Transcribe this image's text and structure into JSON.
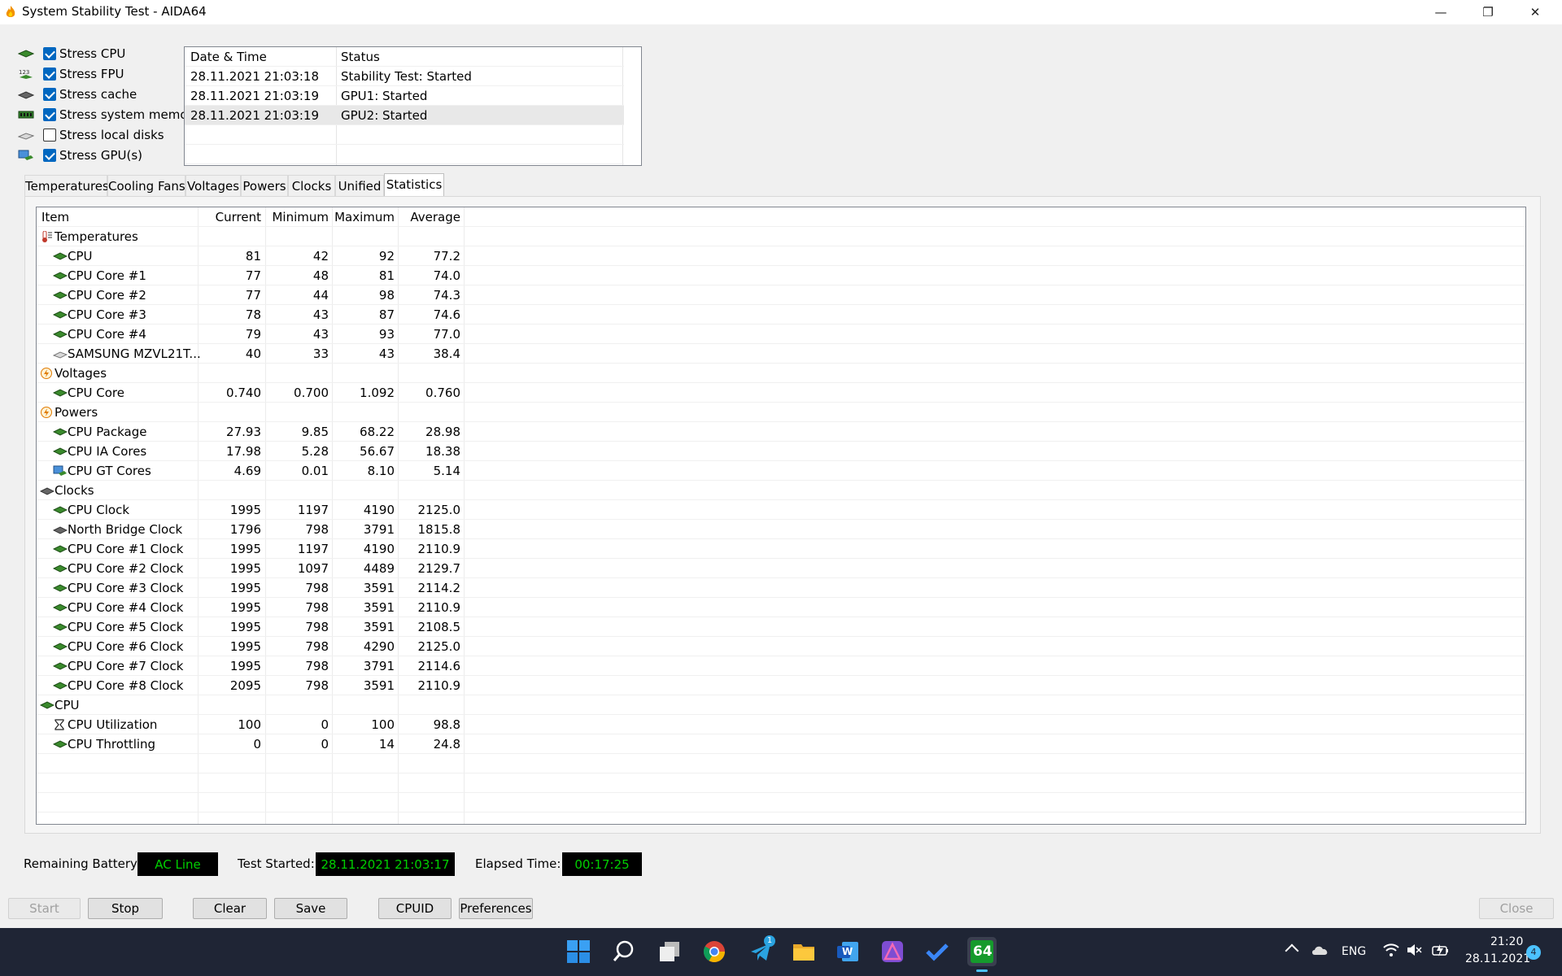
{
  "window": {
    "title": "System Stability Test - AIDA64",
    "minimize_glyph": "—",
    "restore_glyph": "❐",
    "close_glyph": "✕"
  },
  "stress_options": [
    {
      "label": "Stress CPU",
      "checked": true,
      "icon": "cpu-chip-icon"
    },
    {
      "label": "Stress FPU",
      "checked": true,
      "icon": "fpu-123-icon"
    },
    {
      "label": "Stress cache",
      "checked": true,
      "icon": "cache-chip-icon"
    },
    {
      "label": "Stress system memory",
      "checked": true,
      "icon": "memory-module-icon"
    },
    {
      "label": "Stress local disks",
      "checked": false,
      "icon": "disk-drive-icon"
    },
    {
      "label": "Stress GPU(s)",
      "checked": true,
      "icon": "gpu-monitor-icon"
    }
  ],
  "log": {
    "headers": [
      "Date & Time",
      "Status"
    ],
    "rows": [
      [
        "28.11.2021 21:03:18",
        "Stability Test: Started"
      ],
      [
        "28.11.2021 21:03:19",
        "GPU1: Started"
      ],
      [
        "28.11.2021 21:03:19",
        "GPU2: Started"
      ]
    ]
  },
  "tabs": [
    "Temperatures",
    "Cooling Fans",
    "Voltages",
    "Powers",
    "Clocks",
    "Unified",
    "Statistics"
  ],
  "active_tab": "Statistics",
  "stats": {
    "headers": [
      "Item",
      "Current",
      "Minimum",
      "Maximum",
      "Average"
    ],
    "rows": [
      {
        "group": true,
        "icon": "thermometer-icon",
        "item": "Temperatures",
        "cur": "",
        "min": "",
        "max": "",
        "avg": ""
      },
      {
        "icon": "cpu-chip-icon",
        "item": "CPU",
        "cur": "81",
        "min": "42",
        "max": "92",
        "avg": "77.2"
      },
      {
        "icon": "cpu-chip-icon",
        "item": "CPU Core #1",
        "cur": "77",
        "min": "48",
        "max": "81",
        "avg": "74.0"
      },
      {
        "icon": "cpu-chip-icon",
        "item": "CPU Core #2",
        "cur": "77",
        "min": "44",
        "max": "98",
        "avg": "74.3"
      },
      {
        "icon": "cpu-chip-icon",
        "item": "CPU Core #3",
        "cur": "78",
        "min": "43",
        "max": "87",
        "avg": "74.6"
      },
      {
        "icon": "cpu-chip-icon",
        "item": "CPU Core #4",
        "cur": "79",
        "min": "43",
        "max": "93",
        "avg": "77.0"
      },
      {
        "icon": "disk-drive-icon",
        "item": "SAMSUNG MZVL21T...",
        "cur": "40",
        "min": "33",
        "max": "43",
        "avg": "38.4"
      },
      {
        "group": true,
        "icon": "voltage-bolt-icon",
        "item": "Voltages",
        "cur": "",
        "min": "",
        "max": "",
        "avg": ""
      },
      {
        "icon": "cpu-chip-icon",
        "item": "CPU Core",
        "cur": "0.740",
        "min": "0.700",
        "max": "1.092",
        "avg": "0.760"
      },
      {
        "group": true,
        "icon": "power-bolt-icon",
        "item": "Powers",
        "cur": "",
        "min": "",
        "max": "",
        "avg": ""
      },
      {
        "icon": "cpu-chip-icon",
        "item": "CPU Package",
        "cur": "27.93",
        "min": "9.85",
        "max": "68.22",
        "avg": "28.98"
      },
      {
        "icon": "cpu-chip-icon",
        "item": "CPU IA Cores",
        "cur": "17.98",
        "min": "5.28",
        "max": "56.67",
        "avg": "18.38"
      },
      {
        "icon": "gpu-monitor-icon",
        "item": "CPU GT Cores",
        "cur": "4.69",
        "min": "0.01",
        "max": "8.10",
        "avg": "5.14"
      },
      {
        "group": true,
        "icon": "clock-chip-icon",
        "item": "Clocks",
        "cur": "",
        "min": "",
        "max": "",
        "avg": ""
      },
      {
        "icon": "cpu-chip-icon",
        "item": "CPU Clock",
        "cur": "1995",
        "min": "1197",
        "max": "4190",
        "avg": "2125.0"
      },
      {
        "icon": "northbridge-chip-icon",
        "item": "North Bridge Clock",
        "cur": "1796",
        "min": "798",
        "max": "3791",
        "avg": "1815.8"
      },
      {
        "icon": "cpu-chip-icon",
        "item": "CPU Core #1 Clock",
        "cur": "1995",
        "min": "1197",
        "max": "4190",
        "avg": "2110.9"
      },
      {
        "icon": "cpu-chip-icon",
        "item": "CPU Core #2 Clock",
        "cur": "1995",
        "min": "1097",
        "max": "4489",
        "avg": "2129.7"
      },
      {
        "icon": "cpu-chip-icon",
        "item": "CPU Core #3 Clock",
        "cur": "1995",
        "min": "798",
        "max": "3591",
        "avg": "2114.2"
      },
      {
        "icon": "cpu-chip-icon",
        "item": "CPU Core #4 Clock",
        "cur": "1995",
        "min": "798",
        "max": "3591",
        "avg": "2110.9"
      },
      {
        "icon": "cpu-chip-icon",
        "item": "CPU Core #5 Clock",
        "cur": "1995",
        "min": "798",
        "max": "3591",
        "avg": "2108.5"
      },
      {
        "icon": "cpu-chip-icon",
        "item": "CPU Core #6 Clock",
        "cur": "1995",
        "min": "798",
        "max": "4290",
        "avg": "2125.0"
      },
      {
        "icon": "cpu-chip-icon",
        "item": "CPU Core #7 Clock",
        "cur": "1995",
        "min": "798",
        "max": "3791",
        "avg": "2114.6"
      },
      {
        "icon": "cpu-chip-icon",
        "item": "CPU Core #8 Clock",
        "cur": "2095",
        "min": "798",
        "max": "3591",
        "avg": "2110.9"
      },
      {
        "group": true,
        "icon": "cpu-chip-icon",
        "item": "CPU",
        "cur": "",
        "min": "",
        "max": "",
        "avg": ""
      },
      {
        "icon": "hourglass-icon",
        "item": "CPU Utilization",
        "cur": "100",
        "min": "0",
        "max": "100",
        "avg": "98.8"
      },
      {
        "icon": "cpu-chip-icon",
        "item": "CPU Throttling",
        "cur": "0",
        "min": "0",
        "max": "14",
        "avg": "24.8"
      }
    ]
  },
  "status": {
    "battery_label": "Remaining Battery:",
    "battery_value": "AC Line",
    "test_started_label": "Test Started:",
    "test_started_value": "28.11.2021 21:03:17",
    "elapsed_label": "Elapsed Time:",
    "elapsed_value": "00:17:25"
  },
  "buttons": {
    "start": "Start",
    "stop": "Stop",
    "clear": "Clear",
    "save": "Save",
    "cpuid": "CPUID",
    "preferences": "Preferences",
    "close": "Close"
  },
  "taskbar": {
    "apps": [
      "start-icon",
      "search-icon",
      "task-view-icon",
      "chrome-icon",
      "telegram-icon",
      "file-explorer-icon",
      "word-icon",
      "affinity-photo-icon",
      "todo-icon",
      "aida64-icon"
    ],
    "telegram_badge": "1",
    "aida_label": "64",
    "word_label": "W",
    "language": "ENG",
    "time": "21:20",
    "date": "28.11.2021",
    "notification_count": "4"
  },
  "colors": {
    "accent": "#0067c0",
    "lcd_bg": "#000000",
    "lcd_fg": "#00d000",
    "taskbar": "#1f2535"
  }
}
